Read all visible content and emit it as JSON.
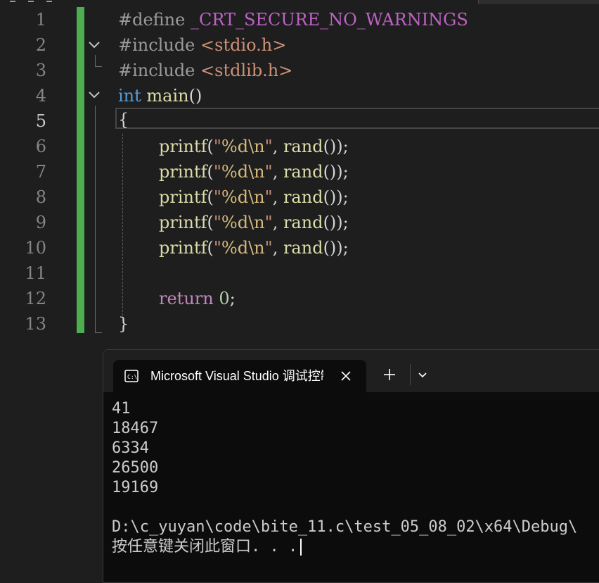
{
  "editor": {
    "line_numbers": [
      "1",
      "2",
      "3",
      "4",
      "5",
      "6",
      "7",
      "8",
      "9",
      "10",
      "11",
      "12",
      "13"
    ],
    "active_line": "5",
    "lines": {
      "l1": {
        "directive": "#define",
        "macro": "_CRT_SECURE_NO_WARNINGS"
      },
      "l2": {
        "directive": "#include",
        "header": "<stdio.h>"
      },
      "l3": {
        "directive": "#include",
        "header": "<stdlib.h>"
      },
      "l4": {
        "type": "int",
        "name": "main",
        "parens": "()"
      },
      "l5": {
        "brace": "{"
      },
      "printf_calls": [
        {
          "fn": "printf",
          "open": "(",
          "q1": "\"",
          "fmt": "%d",
          "esc": "\\n",
          "q2": "\"",
          "comma": ", ",
          "call": "rand",
          "tail": "());"
        },
        {
          "fn": "printf",
          "open": "(",
          "q1": "\"",
          "fmt": "%d",
          "esc": "\\n",
          "q2": "\"",
          "comma": ", ",
          "call": "rand",
          "tail": "());"
        },
        {
          "fn": "printf",
          "open": "(",
          "q1": "\"",
          "fmt": "%d",
          "esc": "\\n",
          "q2": "\"",
          "comma": ", ",
          "call": "rand",
          "tail": "());"
        },
        {
          "fn": "printf",
          "open": "(",
          "q1": "\"",
          "fmt": "%d",
          "esc": "\\n",
          "q2": "\"",
          "comma": ", ",
          "call": "rand",
          "tail": "());"
        },
        {
          "fn": "printf",
          "open": "(",
          "q1": "\"",
          "fmt": "%d",
          "esc": "\\n",
          "q2": "\"",
          "comma": ", ",
          "call": "rand",
          "tail": "());"
        }
      ],
      "l12": {
        "keyword": "return",
        "value": "0",
        "semi": ";"
      },
      "l13": {
        "brace": "}"
      }
    },
    "colors": {
      "change_bar": "#4cae4f",
      "keyword": "#569cd6",
      "function": "#dcdcaa",
      "string": "#ce9178",
      "return": "#c586c0",
      "number": "#b5cea8"
    }
  },
  "terminal": {
    "tab_title": "Microsoft Visual Studio 调试控制台",
    "tab_icon": "console-icon",
    "close_icon": "close-icon",
    "new_tab_icon": "plus-icon",
    "dropdown_icon": "chevron-down-icon",
    "output": [
      "41",
      "18467",
      "6334",
      "26500",
      "19169",
      "",
      "D:\\c_yuyan\\code\\bite_11.c\\test_05_08_02\\x64\\Debug\\"
    ],
    "prompt": "按任意键关闭此窗口. . ."
  }
}
